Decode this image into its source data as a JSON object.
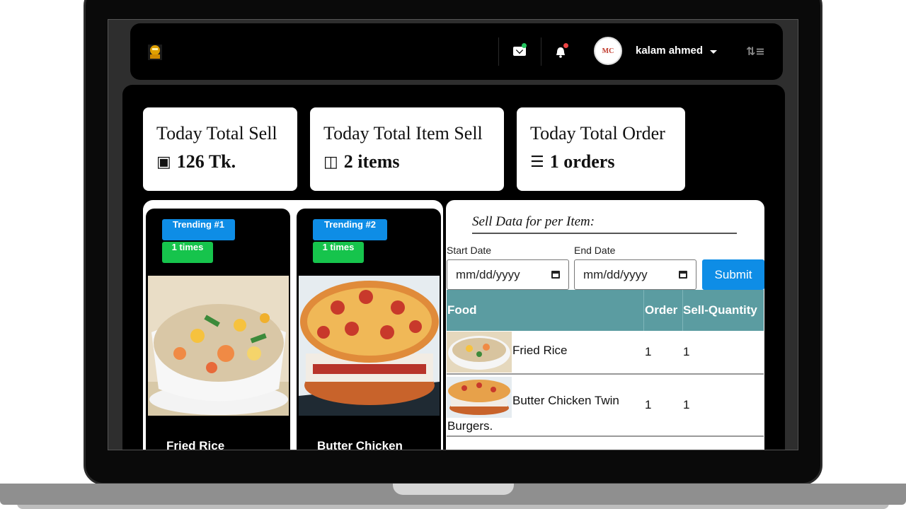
{
  "navbar": {
    "username": "kalam ahmed",
    "avatar_initials": "MC",
    "icons": [
      "logo-icon",
      "mail-icon",
      "bell-icon",
      "menu-icon"
    ],
    "colors": {
      "mail_dot": "#22c55e",
      "bell_dot": "#ef4444"
    }
  },
  "stats": [
    {
      "title": "Today Total Sell",
      "value": "126 Tk.",
      "icon": "cash-icon"
    },
    {
      "title": "Today Total Item Sell",
      "value": "2 items",
      "icon": "battery-chart-icon"
    },
    {
      "title": "Today Total Order",
      "value": "1 orders",
      "icon": "list-icon"
    }
  ],
  "trending": [
    {
      "rank": "Trending #1",
      "times": "1 times",
      "name": "Fried Rice"
    },
    {
      "rank": "Trending #2",
      "times": "1 times",
      "name": "Butter Chicken"
    }
  ],
  "sell_data": {
    "title": "Sell Data for per Item:",
    "start_label": "Start Date",
    "end_label": "End Date",
    "start_placeholder": "mm/dd/yyyy",
    "end_placeholder": "mm/dd/yyyy",
    "submit_label": "Submit",
    "columns": [
      "Food",
      "Order",
      "Sell-Quantity"
    ],
    "rows": [
      {
        "food": "Fried Rice",
        "order": "1",
        "quantity": "1"
      },
      {
        "food": "Butter Chicken Twin Burgers.",
        "order": "1",
        "quantity": "1"
      }
    ],
    "colors": {
      "header": "#5b9ca1",
      "badge_blue": "#0e8de6",
      "badge_green": "#16c44c"
    }
  }
}
